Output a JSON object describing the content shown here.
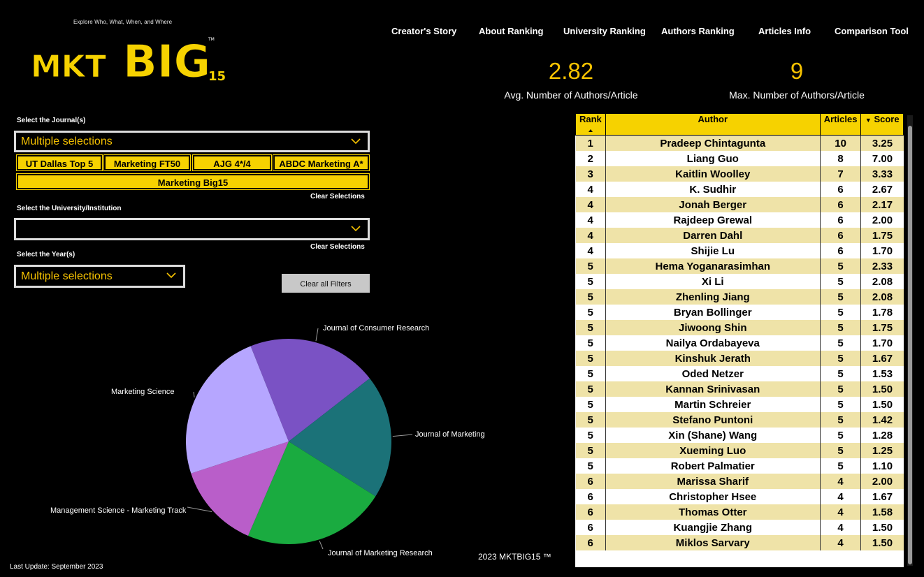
{
  "logo": {
    "tagline": "Explore Who, What, When, and Where",
    "text_main": "MKTBIG",
    "text_sub": "15",
    "trademark": "TM"
  },
  "nav": [
    {
      "label": "Creator's Story"
    },
    {
      "label": "About Ranking"
    },
    {
      "label": "University Ranking"
    },
    {
      "label": "Authors Ranking"
    },
    {
      "label": "Articles Info"
    },
    {
      "label": "Comparison Tool"
    }
  ],
  "kpis": {
    "avg_value": "2.82",
    "avg_label": "Avg. Number of Authors/Article",
    "max_value": "9",
    "max_label": "Max. Number of Authors/Article"
  },
  "filters": {
    "journal_title": "Select the Journal(s)",
    "journal_value": "Multiple selections",
    "chips": [
      "UT Dallas Top 5",
      "Marketing FT50",
      "AJG 4*/4",
      "ABDC Marketing A*",
      "Marketing Big15"
    ],
    "clear_selections": "Clear Selections",
    "university_title": "Select the University/Institution",
    "university_value": "",
    "year_title": "Select the Year(s)",
    "year_value": "Multiple selections",
    "clear_all": "Clear all Filters"
  },
  "chart_data": {
    "type": "pie",
    "slices": [
      {
        "name": "Journal of Consumer Research",
        "value": 20.5,
        "color": "#7a52c4"
      },
      {
        "name": "Journal of Marketing",
        "value": 19.5,
        "color": "#1b7278"
      },
      {
        "name": "Journal of Marketing Research",
        "value": 22.5,
        "color": "#1aab40"
      },
      {
        "name": "Management Science - Marketing Track",
        "value": 13.5,
        "color": "#b95ec9"
      },
      {
        "name": "Marketing Science",
        "value": 24.0,
        "color": "#b6a6ff"
      }
    ]
  },
  "footer": {
    "last_update": "Last Update: September 2023",
    "copyright": "2023 MKTBIG15 ™"
  },
  "table": {
    "headers": [
      "Rank",
      "Author",
      "Articles",
      "Score"
    ],
    "rows": [
      [
        "1",
        "Pradeep Chintagunta",
        "10",
        "3.25"
      ],
      [
        "2",
        "Liang Guo",
        "8",
        "7.00"
      ],
      [
        "3",
        "Kaitlin Woolley",
        "7",
        "3.33"
      ],
      [
        "4",
        "K. Sudhir",
        "6",
        "2.67"
      ],
      [
        "4",
        "Jonah Berger",
        "6",
        "2.17"
      ],
      [
        "4",
        "Rajdeep Grewal",
        "6",
        "2.00"
      ],
      [
        "4",
        "Darren Dahl",
        "6",
        "1.75"
      ],
      [
        "4",
        "Shijie Lu",
        "6",
        "1.70"
      ],
      [
        "5",
        "Hema Yoganarasimhan",
        "5",
        "2.33"
      ],
      [
        "5",
        "Xi Li",
        "5",
        "2.08"
      ],
      [
        "5",
        "Zhenling Jiang",
        "5",
        "2.08"
      ],
      [
        "5",
        "Bryan Bollinger",
        "5",
        "1.78"
      ],
      [
        "5",
        "Jiwoong Shin",
        "5",
        "1.75"
      ],
      [
        "5",
        "Nailya Ordabayeva",
        "5",
        "1.70"
      ],
      [
        "5",
        "Kinshuk Jerath",
        "5",
        "1.67"
      ],
      [
        "5",
        "Oded Netzer",
        "5",
        "1.53"
      ],
      [
        "5",
        "Kannan Srinivasan",
        "5",
        "1.50"
      ],
      [
        "5",
        "Martin Schreier",
        "5",
        "1.50"
      ],
      [
        "5",
        "Stefano Puntoni",
        "5",
        "1.42"
      ],
      [
        "5",
        "Xin (Shane) Wang",
        "5",
        "1.28"
      ],
      [
        "5",
        "Xueming Luo",
        "5",
        "1.25"
      ],
      [
        "5",
        "Robert Palmatier",
        "5",
        "1.10"
      ],
      [
        "6",
        "Marissa Sharif",
        "4",
        "2.00"
      ],
      [
        "6",
        "Christopher Hsee",
        "4",
        "1.67"
      ],
      [
        "6",
        "Thomas Otter",
        "4",
        "1.58"
      ],
      [
        "6",
        "Kuangjie Zhang",
        "4",
        "1.50"
      ],
      [
        "6",
        "Miklos Sarvary",
        "4",
        "1.50"
      ]
    ]
  }
}
